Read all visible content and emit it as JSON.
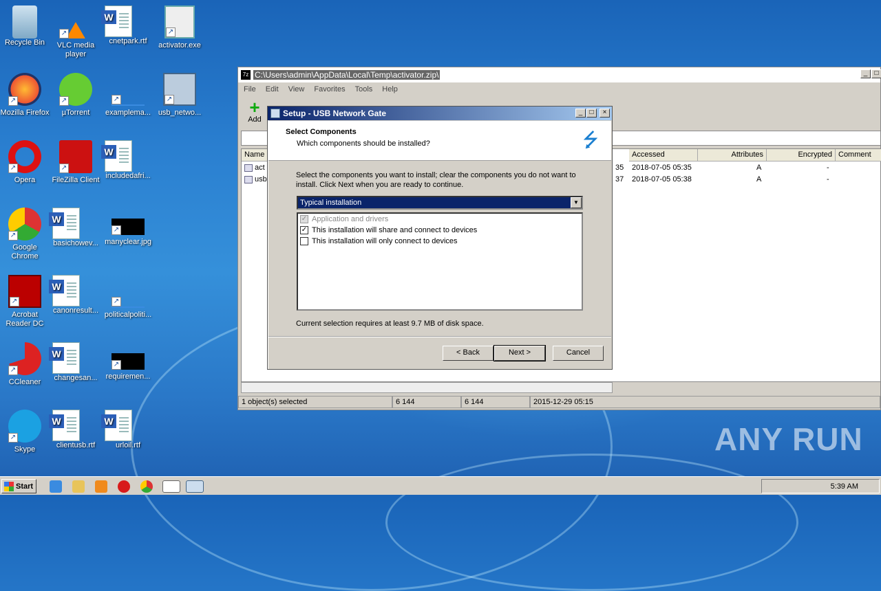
{
  "desktop_icons": [
    {
      "label": "Recycle Bin",
      "icon": "recycle-bin-icon"
    },
    {
      "label": "VLC media player",
      "icon": "vlc-icon"
    },
    {
      "label": "cnetpark.rtf",
      "icon": "word-doc-icon"
    },
    {
      "label": "activator.exe",
      "icon": "exe-icon"
    },
    {
      "label": "Mozilla Firefox",
      "icon": "firefox-icon"
    },
    {
      "label": "µTorrent",
      "icon": "utorrent-icon"
    },
    {
      "label": "examplema...",
      "icon": "blank-file-icon"
    },
    {
      "label": "usb_netwo...",
      "icon": "installer-icon"
    },
    {
      "label": "Opera",
      "icon": "opera-icon"
    },
    {
      "label": "FileZilla Client",
      "icon": "filezilla-icon"
    },
    {
      "label": "includedafri...",
      "icon": "word-doc-icon"
    },
    {
      "label": "Google Chrome",
      "icon": "chrome-icon"
    },
    {
      "label": "basichowev...",
      "icon": "word-doc-icon"
    },
    {
      "label": "manyclear.jpg",
      "icon": "image-file-icon"
    },
    {
      "label": "Acrobat Reader DC",
      "icon": "acrobat-icon"
    },
    {
      "label": "canonresult...",
      "icon": "word-doc-icon"
    },
    {
      "label": "politicalpoliti...",
      "icon": "blank-file-icon"
    },
    {
      "label": "CCleaner",
      "icon": "ccleaner-icon"
    },
    {
      "label": "changesan...",
      "icon": "word-doc-icon"
    },
    {
      "label": "requiremen...",
      "icon": "image-file-icon"
    },
    {
      "label": "Skype",
      "icon": "skype-icon"
    },
    {
      "label": "clientusb.rtf",
      "icon": "word-doc-icon"
    },
    {
      "label": "urloil.rtf",
      "icon": "word-doc-icon"
    }
  ],
  "zip_window": {
    "title": "C:\\Users\\admin\\AppData\\Local\\Temp\\activator.zip\\",
    "menu": [
      "File",
      "Edit",
      "View",
      "Favorites",
      "Tools",
      "Help"
    ],
    "add_label": "Add",
    "columns": [
      "Name",
      "Accessed",
      "Attributes",
      "Encrypted",
      "Comment"
    ],
    "rows": [
      {
        "name": "act",
        "time_frag": "35",
        "accessed": "2018-07-05 05:35",
        "attributes": "A",
        "encrypted": "-"
      },
      {
        "name": "usb",
        "time_frag": "37",
        "accessed": "2018-07-05 05:38",
        "attributes": "A",
        "encrypted": "-"
      }
    ],
    "status": [
      "1 object(s) selected",
      "6 144",
      "6 144",
      "2015-12-29 05:15"
    ]
  },
  "setup": {
    "title": "Setup - USB Network Gate",
    "heading": "Select Components",
    "subheading": "Which components should be installed?",
    "description": "Select the components you want to install; clear the components you do not want to install. Click Next when you are ready to continue.",
    "combo_value": "Typical installation",
    "components": [
      {
        "label": "Application and drivers",
        "checked": true,
        "disabled": true
      },
      {
        "label": "This installation will share and connect to devices",
        "checked": true,
        "disabled": false
      },
      {
        "label": "This installation will only connect to devices",
        "checked": false,
        "disabled": false
      }
    ],
    "disk_text": "Current selection requires at least 9.7 MB of disk space.",
    "back_label": "< Back",
    "next_label": "Next >",
    "cancel_label": "Cancel"
  },
  "taskbar": {
    "start_label": "Start",
    "clock": "5:39 AM"
  },
  "watermark": "ANY RUN"
}
